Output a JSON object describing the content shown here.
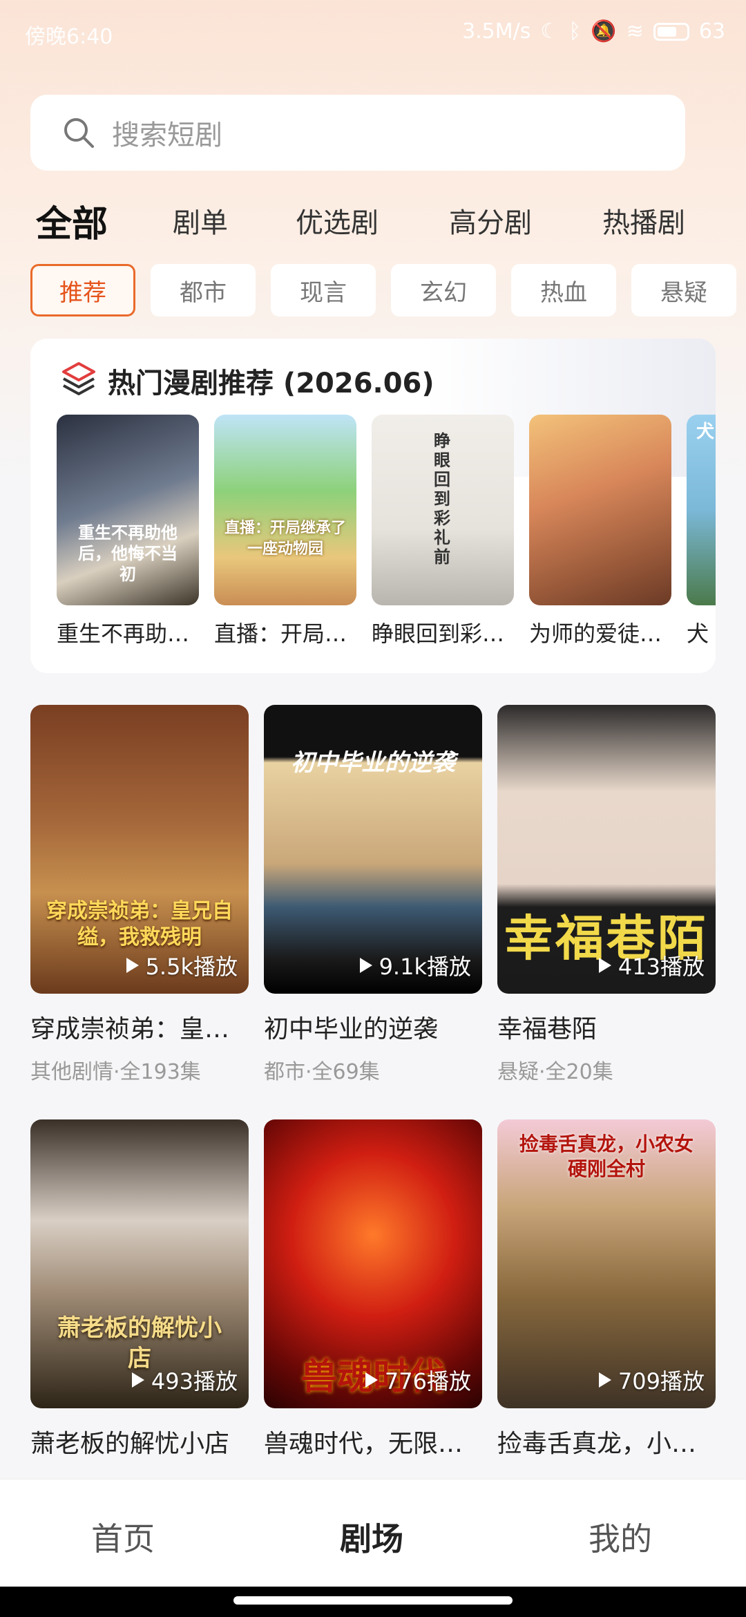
{
  "status": {
    "time": "傍晚6:40",
    "net": "3.5M/s",
    "battery": "63"
  },
  "search": {
    "placeholder": "搜索短剧"
  },
  "top_tabs": [
    "全部",
    "剧单",
    "优选剧",
    "高分剧",
    "热播剧"
  ],
  "chips": [
    "推荐",
    "都市",
    "现言",
    "玄幻",
    "热血",
    "悬疑"
  ],
  "hot": {
    "title": "热门漫剧推荐 (2026.06)",
    "items": [
      {
        "title": "重生不再助…",
        "cover_text": "重生不再助他后，他悔不当初"
      },
      {
        "title": "直播：开局…",
        "cover_text": "直播：开局继承了一座动物园"
      },
      {
        "title": "睁眼回到彩…",
        "cover_text": "睁眼回到彩礼前"
      },
      {
        "title": "为师的爱徒…",
        "cover_text": ""
      },
      {
        "title": "犬",
        "cover_text": "犬"
      }
    ]
  },
  "cards": [
    {
      "name": "穿成崇祯弟：皇…",
      "meta": "其他剧情·全193集",
      "plays": "5.5k播放",
      "overlay": "穿成崇祯弟：皇兄自缢，我救残明"
    },
    {
      "name": "初中毕业的逆袭",
      "meta": "都市·全69集",
      "plays": "9.1k播放",
      "overlay": "初中毕业的逆袭"
    },
    {
      "name": "幸福巷陌",
      "meta": "悬疑·全20集",
      "plays": "413播放",
      "overlay": "幸福巷陌"
    },
    {
      "name": "萧老板的解忧小店",
      "meta": "",
      "plays": "493播放",
      "overlay": "萧老板的解忧小店"
    },
    {
      "name": "兽魂时代，无限…",
      "meta": "",
      "plays": "776播放",
      "overlay": "兽魂时代"
    },
    {
      "name": "捡毒舌真龙，小…",
      "meta": "",
      "plays": "709播放",
      "overlay": "捡毒舌真龙，小农女硬刚全村"
    }
  ],
  "bottom_nav": [
    "首页",
    "剧场",
    "我的"
  ],
  "colors": {
    "accent": "#e5531b"
  }
}
